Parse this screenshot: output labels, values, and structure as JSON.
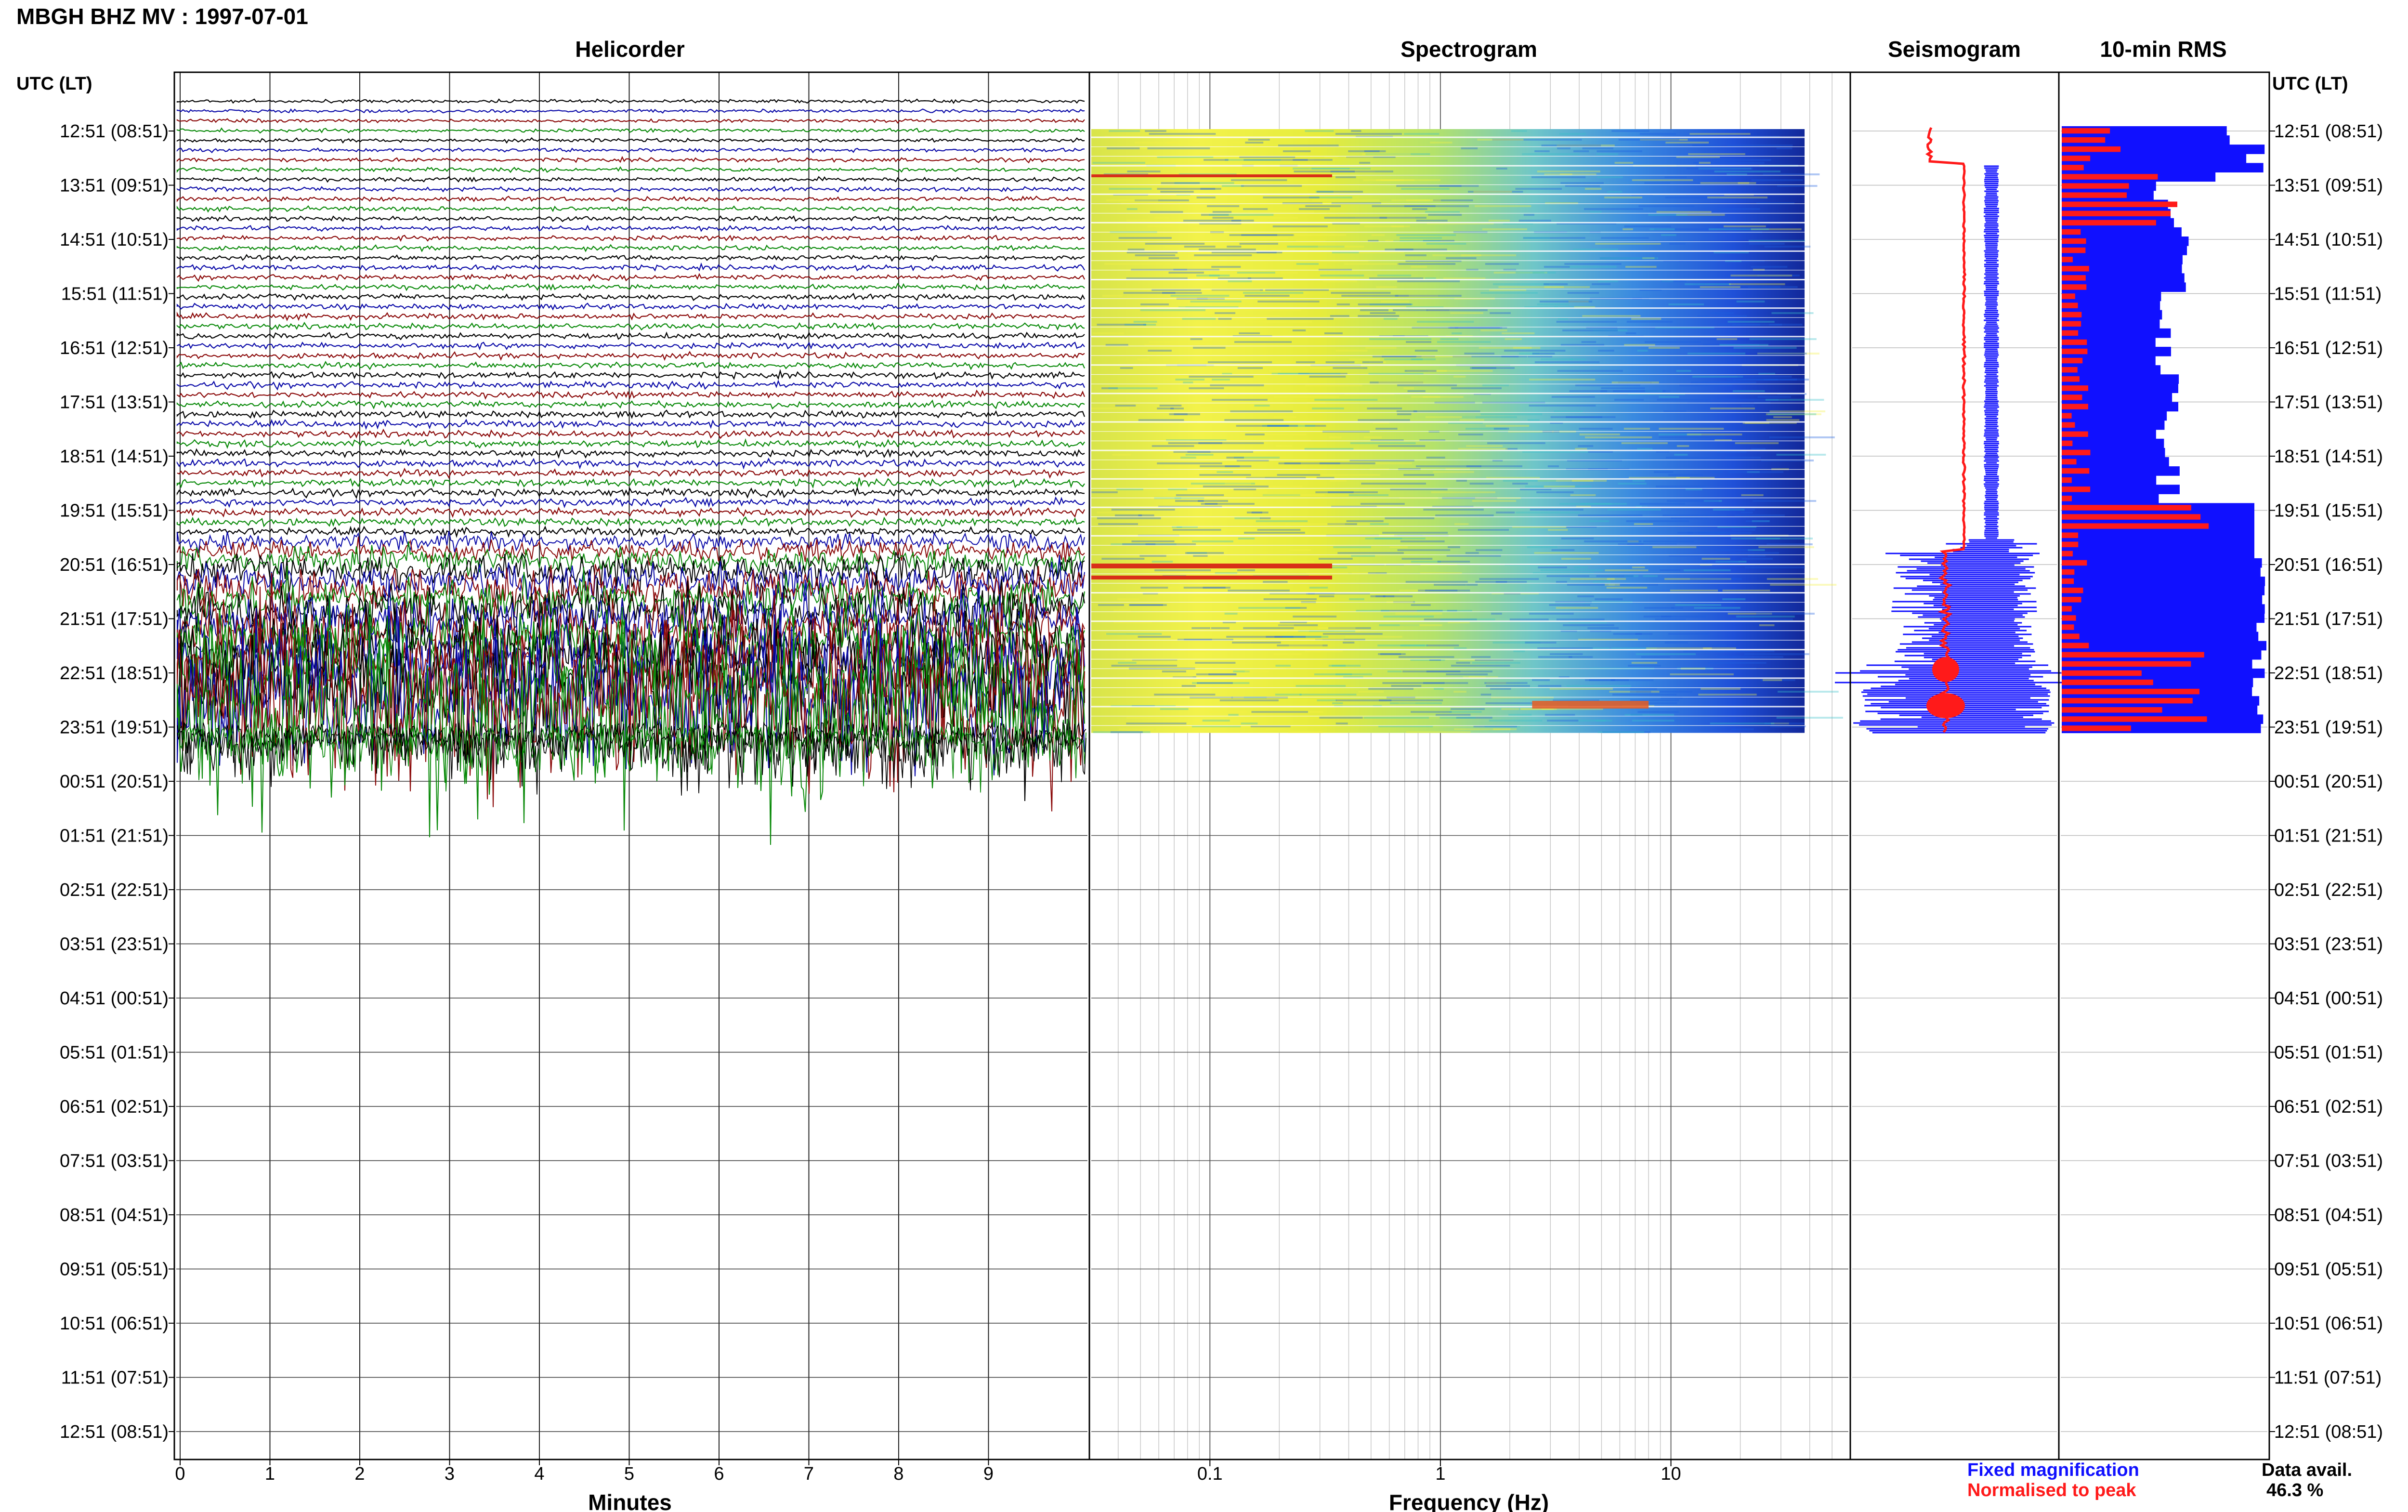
{
  "title": "MBGH BHZ MV : 1997-07-01",
  "panels": {
    "helicorder": "Helicorder",
    "spectrogram": "Spectrogram",
    "seismogram": "Seismogram",
    "rms": "10-min RMS"
  },
  "time_axis": {
    "label": "UTC (LT)",
    "ticks": [
      "12:51 (08:51)",
      "13:51 (09:51)",
      "14:51 (10:51)",
      "15:51 (11:51)",
      "16:51 (12:51)",
      "17:51 (13:51)",
      "18:51 (14:51)",
      "19:51 (15:51)",
      "20:51 (16:51)",
      "21:51 (17:51)",
      "22:51 (18:51)",
      "23:51 (19:51)",
      "00:51 (20:51)",
      "01:51 (21:51)",
      "02:51 (22:51)",
      "03:51 (23:51)",
      "04:51 (00:51)",
      "05:51 (01:51)",
      "06:51 (02:51)",
      "07:51 (03:51)",
      "08:51 (04:51)",
      "09:51 (05:51)",
      "10:51 (06:51)",
      "11:51 (07:51)",
      "12:51 (08:51)"
    ]
  },
  "legend": {
    "fixed": "Fixed magnification",
    "normalised": "Normalised to peak",
    "fixed_color": "#1010ff",
    "normalised_color": "#ff1a1a"
  },
  "availability": {
    "label": "Data avail.",
    "value": "46.3 %",
    "fraction": 0.463
  },
  "chart_data": [
    {
      "type": "line",
      "panel": "Helicorder",
      "xlabel": "Minutes",
      "ylabel": "UTC (LT)",
      "x_ticks": [
        0,
        1,
        2,
        3,
        4,
        5,
        6,
        7,
        8,
        9
      ],
      "xlim": [
        0,
        10
      ],
      "grid": true,
      "trace_colors": [
        "#000000",
        "#0a0aa8",
        "#8b0a0a",
        "#0a8a0a"
      ],
      "data_until": "23:51 (19:51)"
    },
    {
      "type": "heatmap",
      "panel": "Spectrogram",
      "xlabel": "Frequency (Hz)",
      "x_scale": "log",
      "x_ticks": [
        0.1,
        1,
        10
      ],
      "x_tick_labels": [
        "0.1",
        "1",
        "10"
      ],
      "ylabel": "UTC (LT)",
      "grid": true,
      "data_until": "23:51 (19:51)"
    },
    {
      "type": "line",
      "panel": "Seismogram",
      "series": [
        {
          "name": "Fixed magnification",
          "color": "#1010ff"
        },
        {
          "name": "Normalised to peak",
          "color": "#ff1a1a"
        }
      ]
    },
    {
      "type": "bar",
      "panel": "10-min RMS",
      "series": [
        {
          "name": "Fixed magnification",
          "color": "#1010ff"
        },
        {
          "name": "Normalised to peak",
          "color": "#ff1a1a"
        }
      ]
    }
  ]
}
